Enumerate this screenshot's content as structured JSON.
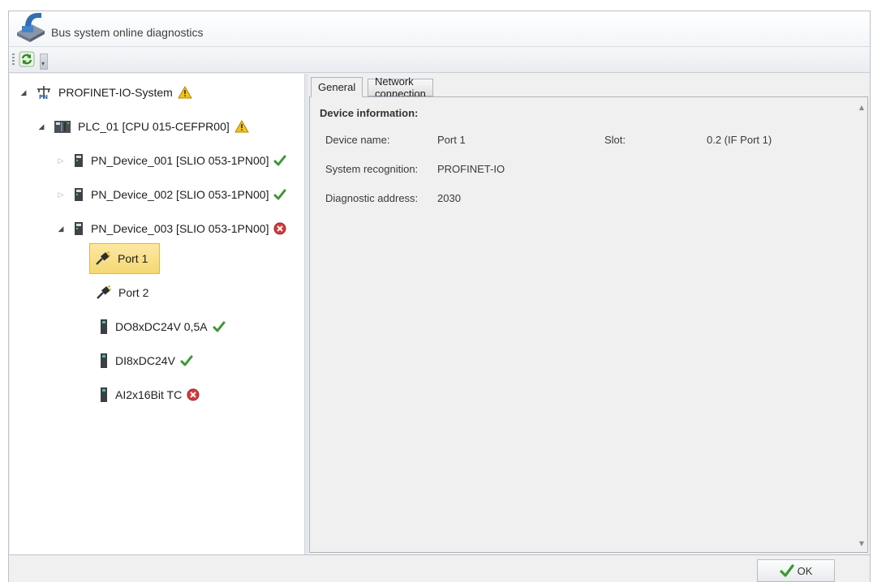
{
  "window": {
    "title": "Bus system online diagnostics"
  },
  "toolbar": {
    "refresh_icon": "refresh-icon"
  },
  "tree": {
    "root": {
      "label": "PROFINET-IO-System",
      "icon": "network-icon",
      "status": "warning"
    },
    "plc": {
      "label": "PLC_01 [CPU 015-CEFPR00]",
      "icon": "cpu-module-icon",
      "status": "warning"
    },
    "devices": [
      {
        "label": "PN_Device_001 [SLIO 053-1PN00]",
        "status": "ok",
        "expanded": false
      },
      {
        "label": "PN_Device_002 [SLIO 053-1PN00]",
        "status": "ok",
        "expanded": false
      },
      {
        "label": "PN_Device_003 [SLIO 053-1PN00]",
        "status": "error",
        "expanded": true
      }
    ],
    "children": [
      {
        "label": "Port 1",
        "icon": "port-icon",
        "status": "",
        "selected": true
      },
      {
        "label": "Port 2",
        "icon": "port-icon",
        "status": ""
      },
      {
        "label": "DO8xDC24V 0,5A",
        "icon": "io-module-icon",
        "status": "ok"
      },
      {
        "label": "DI8xDC24V",
        "icon": "io-module-icon",
        "status": "ok"
      },
      {
        "label": "AI2x16Bit TC",
        "icon": "io-module-icon",
        "status": "error"
      }
    ]
  },
  "tabs": [
    {
      "label": "General",
      "active": true
    },
    {
      "label": "Network connection",
      "active": false
    }
  ],
  "device_info": {
    "heading": "Device information:",
    "device_name_label": "Device name:",
    "device_name_value": "Port 1",
    "slot_label": "Slot:",
    "slot_value": "0.2 (IF Port 1)",
    "system_recognition_label": "System recognition:",
    "system_recognition_value": "PROFINET-IO",
    "diagnostic_address_label": "Diagnostic address:",
    "diagnostic_address_value": "2030"
  },
  "footer": {
    "ok_label": "OK"
  },
  "colors": {
    "ok": "#3a9a2e",
    "warning": "#e8b400",
    "error": "#d9383a",
    "selection": "#f7dc80"
  }
}
